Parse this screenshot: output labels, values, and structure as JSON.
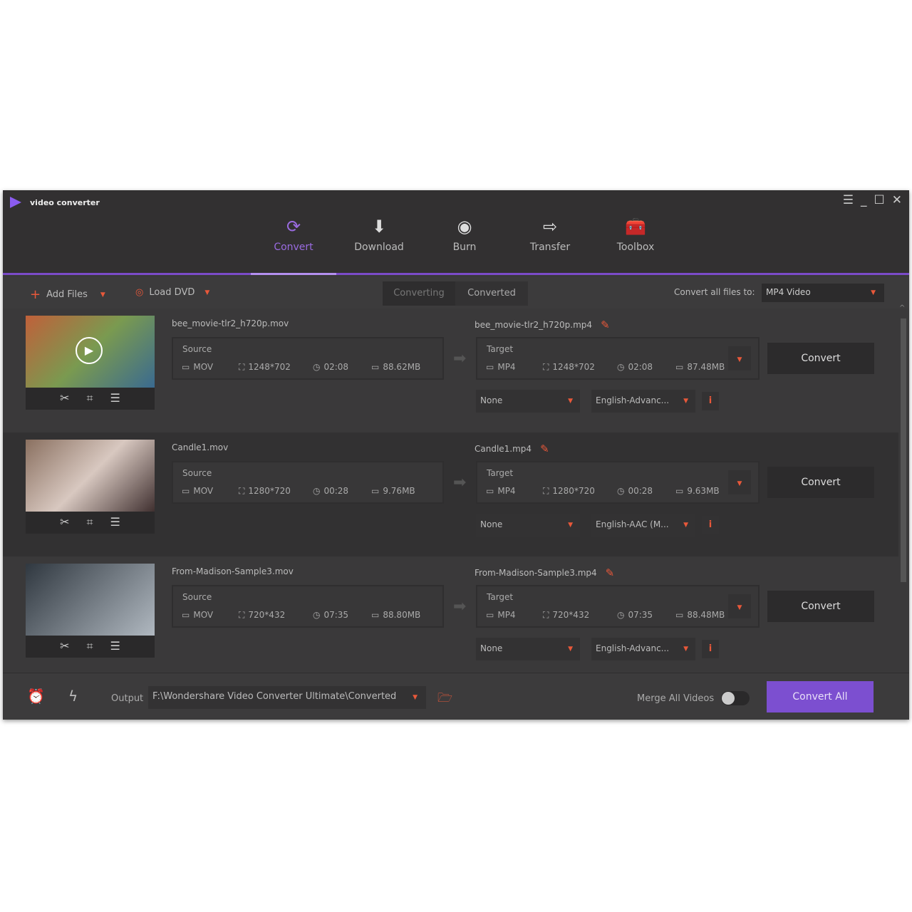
{
  "app": {
    "title": "video converter"
  },
  "window_controls": {
    "menu": "☰",
    "minimize": "_",
    "maximize": "☐",
    "close": "✕"
  },
  "nav": [
    {
      "label": "Convert",
      "icon": "convert-icon",
      "active": true
    },
    {
      "label": "Download",
      "icon": "download-icon"
    },
    {
      "label": "Burn",
      "icon": "burn-icon"
    },
    {
      "label": "Transfer",
      "icon": "transfer-icon"
    },
    {
      "label": "Toolbox",
      "icon": "toolbox-icon"
    }
  ],
  "toolbar": {
    "add_files": "Add Files",
    "load_dvd": "Load DVD",
    "tab_converting": "Converting",
    "tab_converted": "Converted",
    "convert_all_label": "Convert all files to:",
    "format": "MP4 Video"
  },
  "files": [
    {
      "source_name": "bee_movie-tlr2_h720p.mov",
      "target_name": "bee_movie-tlr2_h720p.mp4",
      "source": {
        "label": "Source",
        "format": "MOV",
        "resolution": "1248*702",
        "duration": "02:08",
        "size": "88.62MB"
      },
      "target": {
        "label": "Target",
        "format": "MP4",
        "resolution": "1248*702",
        "duration": "02:08",
        "size": "87.48MB"
      },
      "subtitle": "None",
      "audio": "English-Advanc...",
      "convert": "Convert"
    },
    {
      "source_name": "Candle1.mov",
      "target_name": "Candle1.mp4",
      "source": {
        "label": "Source",
        "format": "MOV",
        "resolution": "1280*720",
        "duration": "00:28",
        "size": "9.76MB"
      },
      "target": {
        "label": "Target",
        "format": "MP4",
        "resolution": "1280*720",
        "duration": "00:28",
        "size": "9.63MB"
      },
      "subtitle": "None",
      "audio": "English-AAC (M...",
      "convert": "Convert"
    },
    {
      "source_name": "From-Madison-Sample3.mov",
      "target_name": "From-Madison-Sample3.mp4",
      "source": {
        "label": "Source",
        "format": "MOV",
        "resolution": "720*432",
        "duration": "07:35",
        "size": "88.80MB"
      },
      "target": {
        "label": "Target",
        "format": "MP4",
        "resolution": "720*432",
        "duration": "07:35",
        "size": "88.48MB"
      },
      "subtitle": "None",
      "audio": "English-Advanc...",
      "convert": "Convert"
    }
  ],
  "footer": {
    "output_label": "Output",
    "output_path": "F:\\Wondershare Video Converter Ultimate\\Converted",
    "merge_label": "Merge All Videos",
    "merge_on": false,
    "convert_all": "Convert All"
  },
  "colors": {
    "accent": "#7b4bc9",
    "convert_all_bg": "#7c4fd0",
    "icon_red": "#e8583a"
  }
}
